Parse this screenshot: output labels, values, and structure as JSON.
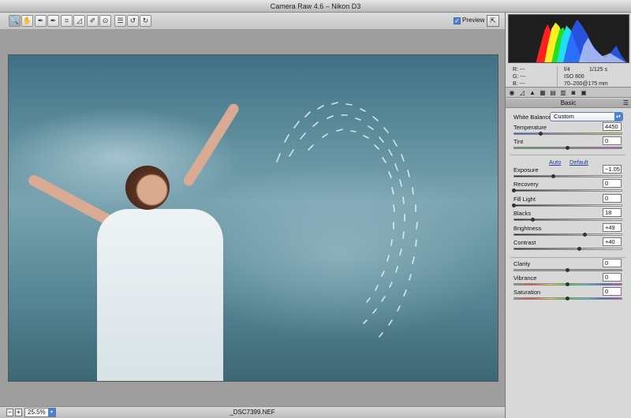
{
  "window": {
    "title": "Camera Raw 4.6  –  Nikon D3"
  },
  "toolbar": {
    "tools": [
      {
        "name": "zoom-tool",
        "glyph": "🔍"
      },
      {
        "name": "hand-tool",
        "glyph": "✋"
      },
      {
        "name": "white-balance-tool",
        "glyph": "✒"
      },
      {
        "name": "color-sampler-tool",
        "glyph": "✒"
      },
      {
        "name": "crop-tool",
        "glyph": "⌗"
      },
      {
        "name": "straighten-tool",
        "glyph": "◿"
      },
      {
        "name": "retouch-tool",
        "glyph": "✐"
      },
      {
        "name": "red-eye-tool",
        "glyph": "⊙"
      },
      {
        "name": "preferences-tool",
        "glyph": "☰"
      },
      {
        "name": "rotate-ccw-tool",
        "glyph": "↺"
      },
      {
        "name": "rotate-cw-tool",
        "glyph": "↻"
      }
    ],
    "preview_label": "Preview",
    "preview_checked": true
  },
  "histogram_info": {
    "r": "R:  ---",
    "g": "G:  ---",
    "b": "B:  ---",
    "aperture": "f/4",
    "shutter": "1/125 s",
    "iso": "ISO 800",
    "lens": "70–200@175 mm"
  },
  "panel": {
    "title": "Basic",
    "white_balance_label": "White Balance:",
    "white_balance_value": "Custom",
    "auto_label": "Auto",
    "default_label": "Default",
    "sliders": [
      {
        "key": "temperature",
        "label": "Temperature",
        "value": "4450",
        "pos": 0.25,
        "track": "temp"
      },
      {
        "key": "tint",
        "label": "Tint",
        "value": "0",
        "pos": 0.5,
        "track": "tint"
      },
      {
        "key": "exposure",
        "label": "Exposure",
        "value": "−1.05",
        "pos": 0.37,
        "track": "gray"
      },
      {
        "key": "recovery",
        "label": "Recovery",
        "value": "0",
        "pos": 0.0,
        "track": "gray"
      },
      {
        "key": "fill-light",
        "label": "Fill Light",
        "value": "0",
        "pos": 0.0,
        "track": "gray"
      },
      {
        "key": "blacks",
        "label": "Blacks",
        "value": "18",
        "pos": 0.18,
        "track": "gray"
      },
      {
        "key": "brightness",
        "label": "Brightness",
        "value": "+49",
        "pos": 0.66,
        "track": "gray"
      },
      {
        "key": "contrast",
        "label": "Contrast",
        "value": "+40",
        "pos": 0.61,
        "track": "gray"
      },
      {
        "key": "clarity",
        "label": "Clarity",
        "value": "0",
        "pos": 0.5,
        "track": "plain"
      },
      {
        "key": "vibrance",
        "label": "Vibrance",
        "value": "0",
        "pos": 0.5,
        "track": "vib"
      },
      {
        "key": "saturation",
        "label": "Saturation",
        "value": "0",
        "pos": 0.5,
        "track": "vib"
      }
    ]
  },
  "bottom": {
    "zoom_value": "25.5%",
    "filename": "_DSC7399.NEF"
  }
}
